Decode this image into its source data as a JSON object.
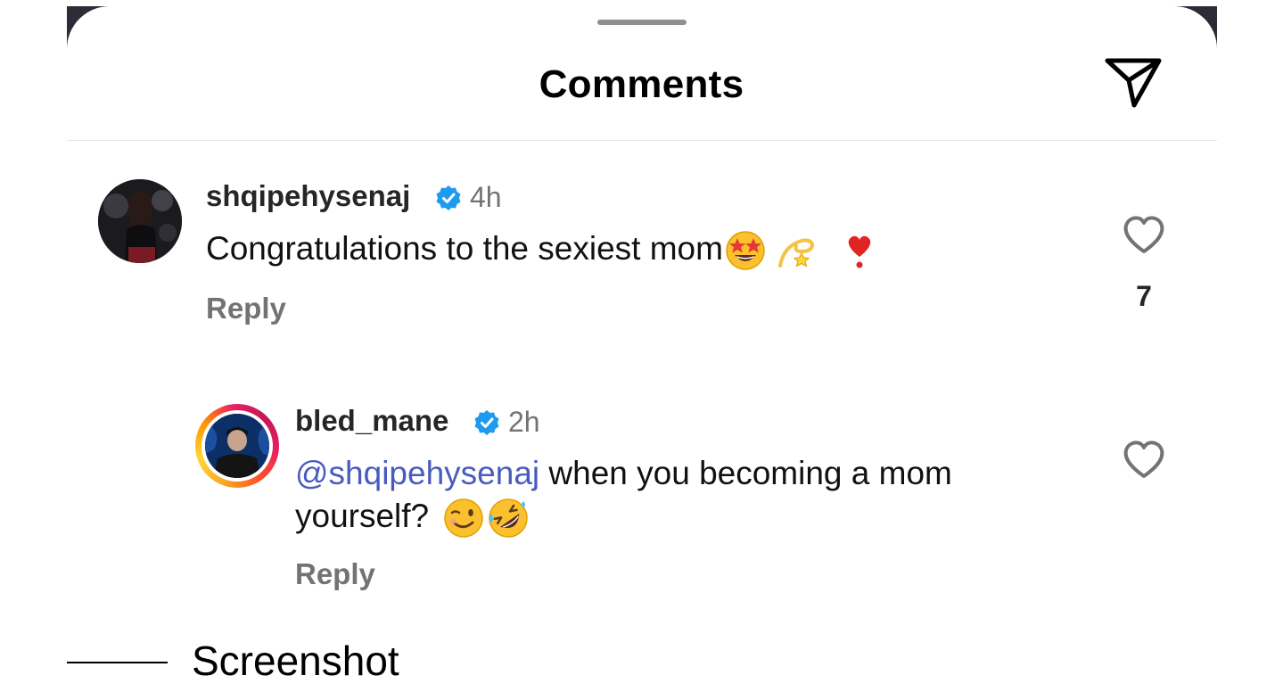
{
  "header": {
    "title": "Comments",
    "share_icon": "paper-plane-icon"
  },
  "comments": [
    {
      "username": "shqipehysenaj",
      "verified": true,
      "time": "4h",
      "text": "Congratulations to the sexiest mom",
      "emojis": [
        "star-struck",
        "dizzy",
        "heart-exclamation"
      ],
      "reply_label": "Reply",
      "likes": "7"
    },
    {
      "username": "bled_mane",
      "verified": true,
      "time": "2h",
      "mention": "@shqipehysenaj",
      "text_line1": " when you becoming a mom",
      "text_line2": "yourself?",
      "emojis": [
        "winking-face",
        "rolling-on-floor-laughing"
      ],
      "reply_label": "Reply",
      "has_story_ring": true
    }
  ],
  "caption": "Screenshot",
  "colors": {
    "mention": "#4a5bbf",
    "verified": "#1d9bf0",
    "secondary_text": "#737373"
  }
}
